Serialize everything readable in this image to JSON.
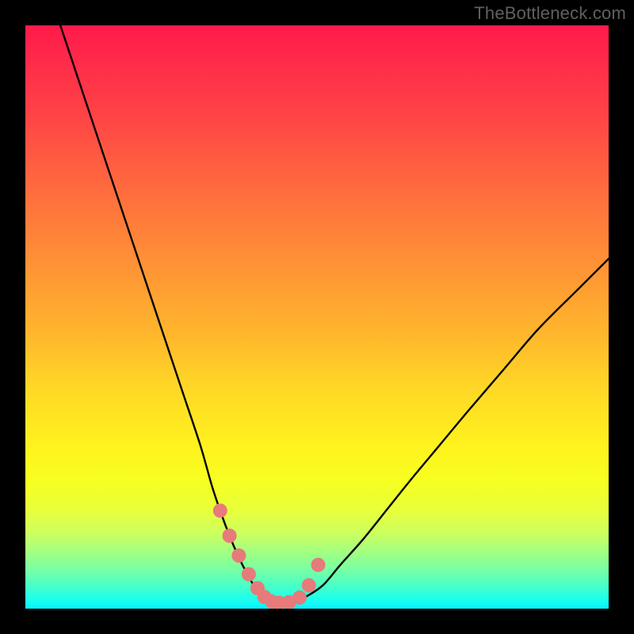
{
  "watermark": "TheBottleneck.com",
  "chart_data": {
    "type": "line",
    "title": "",
    "xlabel": "",
    "ylabel": "",
    "xlim": [
      0,
      100
    ],
    "ylim": [
      0,
      100
    ],
    "series": [
      {
        "name": "bottleneck-curve",
        "x": [
          6,
          9,
          12,
          15,
          18,
          21,
          24,
          27,
          30,
          32,
          33.5,
          35,
          36.5,
          38,
          39.5,
          41,
          42.5,
          45.5,
          48,
          51,
          54,
          58,
          62,
          66,
          71,
          76,
          82,
          88,
          95,
          100
        ],
        "values": [
          100,
          91,
          82,
          73,
          64,
          55,
          46,
          37,
          28,
          21,
          16.5,
          12.5,
          9,
          6,
          3.5,
          2,
          1,
          1,
          2,
          4,
          7.5,
          12,
          17,
          22,
          28,
          34,
          41,
          48,
          55,
          60
        ]
      }
    ],
    "markers": {
      "name": "bottleneck-valley-markers",
      "color": "#e77a7a",
      "radius_px": 9,
      "x": [
        33.4,
        35.0,
        36.6,
        38.3,
        39.8,
        41.0,
        42.3,
        43.5,
        45.2,
        47.0,
        48.6,
        50.2
      ],
      "values": [
        16.8,
        12.5,
        9.1,
        5.9,
        3.5,
        2.0,
        1.2,
        1.0,
        1.1,
        1.9,
        4.0,
        7.5
      ]
    },
    "gradient_scale": {
      "direction": "vertical",
      "top_value": 100,
      "bottom_value": 0,
      "stops": [
        {
          "pos": 0.0,
          "color": "#ff1a4a"
        },
        {
          "pos": 0.28,
          "color": "#ff6b3e"
        },
        {
          "pos": 0.62,
          "color": "#ffd726"
        },
        {
          "pos": 0.83,
          "color": "#e8ff3a"
        },
        {
          "pos": 0.96,
          "color": "#4affc6"
        },
        {
          "pos": 1.0,
          "color": "#06f3ff"
        }
      ]
    }
  }
}
